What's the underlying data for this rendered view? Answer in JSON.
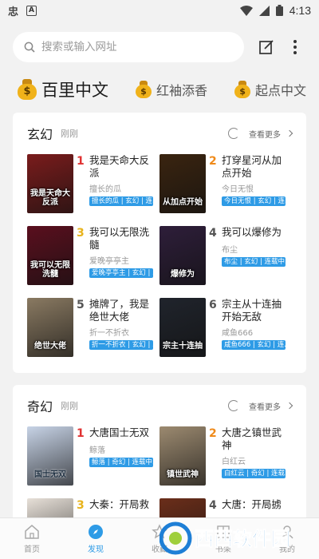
{
  "status": {
    "time": "4:13"
  },
  "search": {
    "placeholder": "搜索或输入网址"
  },
  "tabs": [
    {
      "label": "百里中文",
      "active": true
    },
    {
      "label": "红袖添香",
      "active": false
    },
    {
      "label": "起点中文",
      "active": false
    }
  ],
  "sections": [
    {
      "title": "玄幻",
      "time": "刚刚",
      "more": "查看更多",
      "books": [
        {
          "rank": "1",
          "title": "我是天命大反派",
          "author": "擅长的瓜",
          "tags": "擅长的瓜 | 玄幻 | 连...",
          "cover_text": "我是天命大反派",
          "cover_color": "#7a1c1c"
        },
        {
          "rank": "2",
          "title": "打穿星河从加点开始",
          "author": "今日无恨",
          "tags": "今日无恨 | 玄幻 | 连...",
          "cover_text": "从加点开始",
          "cover_color": "#3a2410"
        },
        {
          "rank": "3",
          "title": "我可以无限洗髓",
          "author": "爱晚亭亭主",
          "tags": "爱晚亭亭主 | 玄幻 | ...",
          "cover_text": "我可以无限洗髓",
          "cover_color": "#5a0f1e"
        },
        {
          "rank": "4",
          "title": "我可以爆修为",
          "author": "布尘",
          "tags": "布尘 | 玄幻 | 连载中...",
          "cover_text": "爆修为",
          "cover_color": "#2e1e3a"
        },
        {
          "rank": "5",
          "title": "摊牌了，我是绝世大佬",
          "author": "折一不折衣",
          "tags": "折一不折衣 | 玄幻 | ...",
          "cover_text": "绝世大佬",
          "cover_color": "#8a7a62"
        },
        {
          "rank": "6",
          "title": "宗主从十连抽开始无敌",
          "author": "咸鱼666",
          "tags": "咸鱼666 | 玄幻 | 连...",
          "cover_text": "宗主十连抽",
          "cover_color": "#20242c"
        }
      ]
    },
    {
      "title": "奇幻",
      "time": "刚刚",
      "more": "查看更多",
      "books": [
        {
          "rank": "1",
          "title": "大唐国士无双",
          "author": "鲸落",
          "tags": "鲸落 | 奇幻 | 连载中...",
          "cover_text": "国士无双",
          "cover_color": "#c7d3e6"
        },
        {
          "rank": "2",
          "title": "大唐之镇世武神",
          "author": "白红云",
          "tags": "白红云 | 奇幻 | 连载...",
          "cover_text": "镇世武神",
          "cover_color": "#9c8a70"
        },
        {
          "rank": "3",
          "title": "大秦：开局救",
          "author": "",
          "tags": "",
          "cover_text": "",
          "cover_color": "#e7e0d8"
        },
        {
          "rank": "4",
          "title": "大唐：开局掳",
          "author": "",
          "tags": "",
          "cover_text": "",
          "cover_color": "#6b2e1a"
        }
      ]
    }
  ],
  "nav": [
    {
      "label": "首页",
      "active": false
    },
    {
      "label": "发现",
      "active": true
    },
    {
      "label": "收藏",
      "active": false
    },
    {
      "label": "书架",
      "active": false
    },
    {
      "label": "我的",
      "active": false
    }
  ],
  "watermark": {
    "text": "西西软件园",
    "color": "#1e7fd6"
  },
  "colors": {
    "accent": "#2e9be6",
    "rank1": "#e03232",
    "rank2": "#ef8a1a",
    "rank3": "#e8b31c"
  }
}
